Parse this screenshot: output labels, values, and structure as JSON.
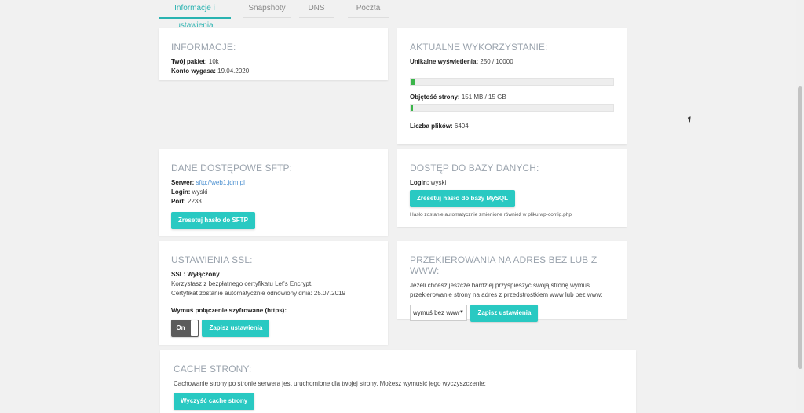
{
  "tabs": [
    "Informacje i ustawienia",
    "Snapshoty",
    "DNS",
    "Poczta"
  ],
  "info": {
    "title": "INFORMACJE:",
    "package_label": "Twój pakiet:",
    "package_value": "10k",
    "expires_label": "Konto wygasa:",
    "expires_value": "19.04.2020"
  },
  "usage": {
    "title": "AKTUALNE WYKORZYSTANIE:",
    "views_label": "Unikalne wyświetlenia:",
    "views_value": "250 / 10000",
    "views_fraction": 0.025,
    "size_label": "Objętość strony:",
    "size_value": "151 MB / 15 GB",
    "size_fraction": 0.01,
    "files_label": "Liczba plików:",
    "files_value": "6404"
  },
  "sftp": {
    "title": "DANE DOSTĘPOWE SFTP:",
    "server_label": "Serwer:",
    "server_value": "sftp://web1.jdm.pl",
    "login_label": "Login:",
    "login_value": "wyski",
    "port_label": "Port:",
    "port_value": "2233",
    "button": "Zresetuj hasło do SFTP"
  },
  "db": {
    "title": "DOSTĘP DO BAZY DANYCH:",
    "login_label": "Login:",
    "login_value": "wyski",
    "button": "Zresetuj hasło do bazy MySQL",
    "note": "Hasło zostanie automatycznie zmienione również w pliku wp-config.php"
  },
  "ssl": {
    "title": "USTAWIENIA SSL:",
    "status": "SSL: Wyłączony",
    "line1": "Korzystasz z bezpłatnego certyfikatu Let's Encrypt.",
    "line2": "Certyfikat zostanie automatycznie odnowiony dnia: 25.07.2019",
    "force_label": "Wymuś połączenie szyfrowane (https):",
    "toggle_label": "On",
    "button": "Zapisz ustawienia"
  },
  "redirect": {
    "title": "PRZEKIEROWANIA NA ADRES BEZ LUB Z WWW:",
    "line1": "Jeżeli chcesz jeszcze bardziej przyśpieszyć swoją stronę wymuś",
    "line2": "przekierowanie strony na adres z przedstrostkiem www lub bez www:",
    "select_value": "wymuś bez www",
    "button": "Zapisz ustawienia"
  },
  "cache": {
    "title": "CACHE STRONY:",
    "line": "Cachowanie strony po stronie serwera jest uruchomione dla twojej strony. Możesz wymusić jego wyczyszczenie:",
    "button": "Wyczyść cache strony"
  }
}
